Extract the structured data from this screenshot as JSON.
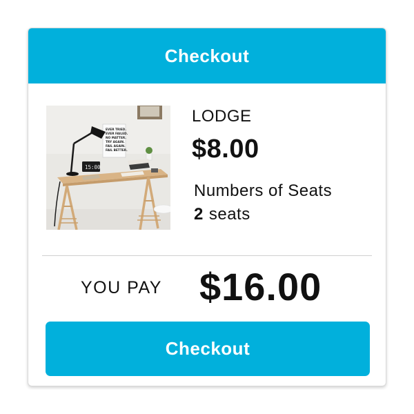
{
  "header": {
    "title": "Checkout"
  },
  "item": {
    "image_icon": "product-photo",
    "name": "LODGE",
    "price": "$8.00",
    "seats_label": "Numbers of Seats",
    "seats_count": "2",
    "seats_unit": "seats",
    "sign_text": [
      "EVER TRIED.",
      "EVER FAILED.",
      "NO MATTER.",
      "TRY AGAIN.",
      "FAIL AGAIN.",
      "FAIL BETTER."
    ],
    "clock_text": "15:00"
  },
  "summary": {
    "label": "YOU PAY",
    "total": "$16.00"
  },
  "actions": {
    "checkout_label": "Checkout"
  },
  "colors": {
    "accent": "#01b0dc",
    "text": "#111111",
    "button_text": "#ffffff"
  }
}
